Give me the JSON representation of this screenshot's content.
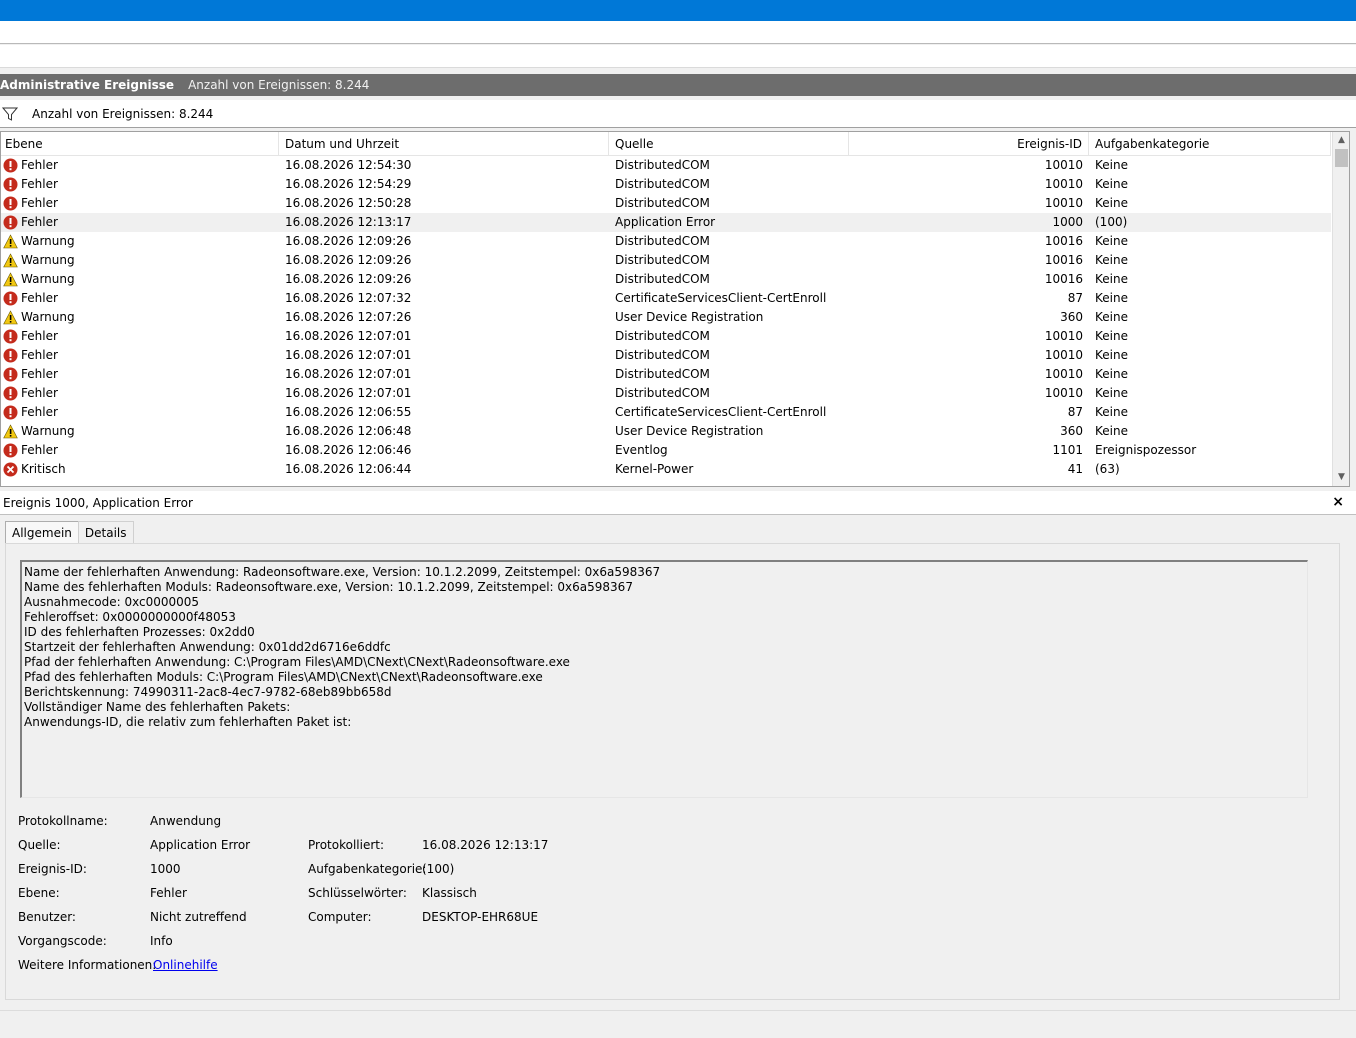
{
  "view_header": {
    "title": "Administrative Ereignisse",
    "count": "Anzahl von Ereignissen: 8.244"
  },
  "filter_bar": {
    "icon": "filter-icon",
    "text": "Anzahl von Ereignissen: 8.244"
  },
  "grid": {
    "columns": [
      "Ebene",
      "Datum und Uhrzeit",
      "Quelle",
      "Ereignis-ID",
      "Aufgabenkategorie"
    ],
    "rows": [
      {
        "level": "Fehler",
        "icon": "error-icon",
        "date": "16.08.2026 12:54:30",
        "source": "DistributedCOM",
        "id": "10010",
        "category": "Keine"
      },
      {
        "level": "Fehler",
        "icon": "error-icon",
        "date": "16.08.2026 12:54:29",
        "source": "DistributedCOM",
        "id": "10010",
        "category": "Keine"
      },
      {
        "level": "Fehler",
        "icon": "error-icon",
        "date": "16.08.2026 12:50:28",
        "source": "DistributedCOM",
        "id": "10010",
        "category": "Keine"
      },
      {
        "level": "Fehler",
        "icon": "error-icon",
        "date": "16.08.2026 12:13:17",
        "source": "Application Error",
        "id": "1000",
        "category": "(100)",
        "selected": true
      },
      {
        "level": "Warnung",
        "icon": "warning-icon",
        "date": "16.08.2026 12:09:26",
        "source": "DistributedCOM",
        "id": "10016",
        "category": "Keine"
      },
      {
        "level": "Warnung",
        "icon": "warning-icon",
        "date": "16.08.2026 12:09:26",
        "source": "DistributedCOM",
        "id": "10016",
        "category": "Keine"
      },
      {
        "level": "Warnung",
        "icon": "warning-icon",
        "date": "16.08.2026 12:09:26",
        "source": "DistributedCOM",
        "id": "10016",
        "category": "Keine"
      },
      {
        "level": "Fehler",
        "icon": "error-icon",
        "date": "16.08.2026 12:07:32",
        "source": "CertificateServicesClient-CertEnroll",
        "id": "87",
        "category": "Keine"
      },
      {
        "level": "Warnung",
        "icon": "warning-icon",
        "date": "16.08.2026 12:07:26",
        "source": "User Device Registration",
        "id": "360",
        "category": "Keine"
      },
      {
        "level": "Fehler",
        "icon": "error-icon",
        "date": "16.08.2026 12:07:01",
        "source": "DistributedCOM",
        "id": "10010",
        "category": "Keine"
      },
      {
        "level": "Fehler",
        "icon": "error-icon",
        "date": "16.08.2026 12:07:01",
        "source": "DistributedCOM",
        "id": "10010",
        "category": "Keine"
      },
      {
        "level": "Fehler",
        "icon": "error-icon",
        "date": "16.08.2026 12:07:01",
        "source": "DistributedCOM",
        "id": "10010",
        "category": "Keine"
      },
      {
        "level": "Fehler",
        "icon": "error-icon",
        "date": "16.08.2026 12:07:01",
        "source": "DistributedCOM",
        "id": "10010",
        "category": "Keine"
      },
      {
        "level": "Fehler",
        "icon": "error-icon",
        "date": "16.08.2026 12:06:55",
        "source": "CertificateServicesClient-CertEnroll",
        "id": "87",
        "category": "Keine"
      },
      {
        "level": "Warnung",
        "icon": "warning-icon",
        "date": "16.08.2026 12:06:48",
        "source": "User Device Registration",
        "id": "360",
        "category": "Keine"
      },
      {
        "level": "Fehler",
        "icon": "error-icon",
        "date": "16.08.2026 12:06:46",
        "source": "Eventlog",
        "id": "1101",
        "category": "Ereignispozessor"
      },
      {
        "level": "Kritisch",
        "icon": "critical-icon",
        "date": "16.08.2026 12:06:44",
        "source": "Kernel-Power",
        "id": "41",
        "category": "(63)"
      }
    ]
  },
  "detail": {
    "header": "Ereignis 1000, Application Error",
    "close_label": "×",
    "tabs": [
      "Allgemein",
      "Details"
    ],
    "description": [
      "Name der fehlerhaften Anwendung: Radeonsoftware.exe, Version: 10.1.2.2099, Zeitstempel: 0x6a598367",
      "Name des fehlerhaften Moduls: Radeonsoftware.exe, Version: 10.1.2.2099, Zeitstempel: 0x6a598367",
      "Ausnahmecode: 0xc0000005",
      "Fehleroffset: 0x0000000000f48053",
      "ID des fehlerhaften Prozesses: 0x2dd0",
      "Startzeit der fehlerhaften Anwendung: 0x01dd2d6716e6ddfc",
      "Pfad der fehlerhaften Anwendung: C:\\Program Files\\AMD\\CNext\\CNext\\Radeonsoftware.exe",
      "Pfad des fehlerhaften Moduls: C:\\Program Files\\AMD\\CNext\\CNext\\Radeonsoftware.exe",
      "Berichtskennung: 74990311-2ac8-4ec7-9782-68eb89bb658d",
      "Vollständiger Name des fehlerhaften Pakets:",
      "Anwendungs-ID, die relativ zum fehlerhaften Paket ist:"
    ],
    "properties": {
      "log_name_label": "Protokollname:",
      "log_name": "Anwendung",
      "source_label": "Quelle:",
      "source": "Application Error",
      "logged_label": "Protokolliert:",
      "logged": "16.08.2026 12:13:17",
      "event_id_label": "Ereignis-ID:",
      "event_id": "1000",
      "task_category_label": "Aufgabenkategorie:",
      "task_category": "(100)",
      "level_label": "Ebene:",
      "level": "Fehler",
      "keywords_label": "Schlüsselwörter:",
      "keywords": "Klassisch",
      "user_label": "Benutzer:",
      "user": "Nicht zutreffend",
      "computer_label": "Computer:",
      "computer": "DESKTOP-EHR68UE",
      "opcode_label": "Vorgangscode:",
      "opcode": "Info",
      "more_info_label": "Weitere Informationen:",
      "more_info_link": "Onlinehilfe"
    }
  },
  "colors": {
    "titlebar": "#0078d7",
    "header_bar": "#6d6d6d",
    "error": "#c42b1c",
    "warning": "#f2c811",
    "link": "#0000ee"
  }
}
